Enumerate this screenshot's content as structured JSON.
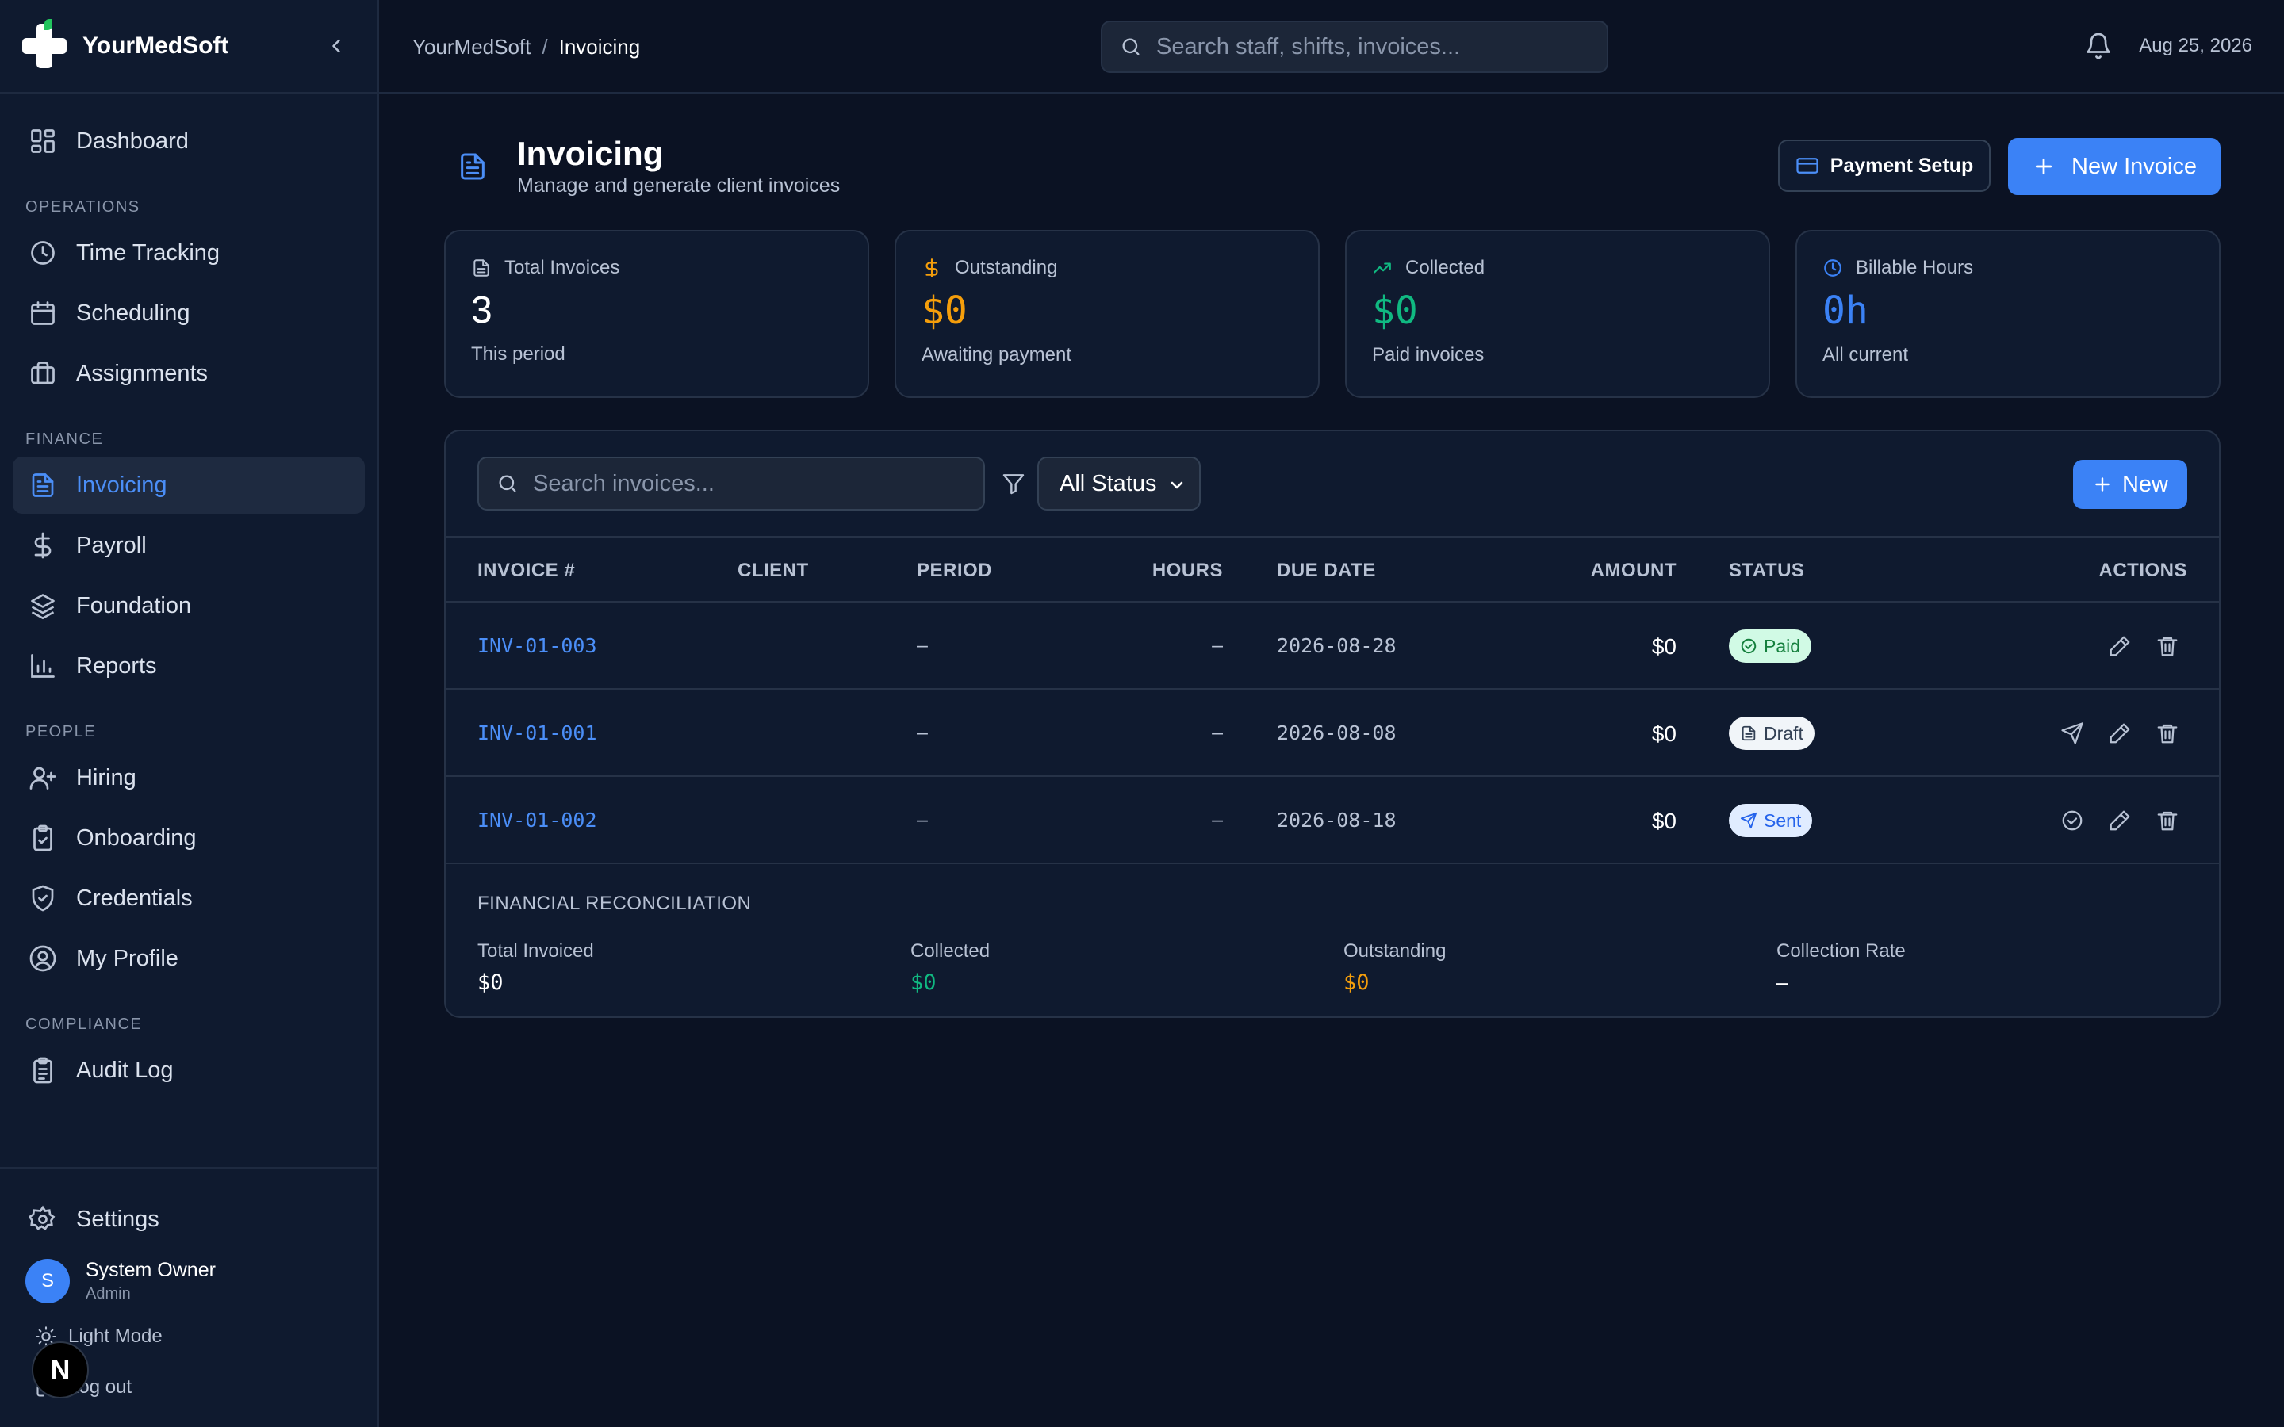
{
  "app": {
    "name": "YourMedSoft"
  },
  "sidebar": {
    "top_items": [
      {
        "label": "Dashboard",
        "icon": "dashboard-icon"
      }
    ],
    "sections": [
      {
        "label": "OPERATIONS",
        "items": [
          {
            "label": "Time Tracking",
            "icon": "clock-icon"
          },
          {
            "label": "Scheduling",
            "icon": "calendar-icon"
          },
          {
            "label": "Assignments",
            "icon": "briefcase-icon"
          }
        ]
      },
      {
        "label": "FINANCE",
        "items": [
          {
            "label": "Invoicing",
            "icon": "file-icon",
            "active": true
          },
          {
            "label": "Payroll",
            "icon": "dollar-icon"
          },
          {
            "label": "Foundation",
            "icon": "layers-icon"
          },
          {
            "label": "Reports",
            "icon": "bar-chart-icon"
          }
        ]
      },
      {
        "label": "PEOPLE",
        "items": [
          {
            "label": "Hiring",
            "icon": "user-plus-icon"
          },
          {
            "label": "Onboarding",
            "icon": "clipboard-check-icon"
          },
          {
            "label": "Credentials",
            "icon": "shield-check-icon"
          },
          {
            "label": "My Profile",
            "icon": "user-circle-icon"
          }
        ]
      },
      {
        "label": "COMPLIANCE",
        "items": [
          {
            "label": "Audit Log",
            "icon": "clipboard-list-icon"
          }
        ]
      }
    ],
    "settings_label": "Settings",
    "user": {
      "initial": "S",
      "name": "System Owner",
      "role": "Admin"
    },
    "theme_label": "Light Mode",
    "logout_label": "Log out",
    "next_badge": "N"
  },
  "topbar": {
    "breadcrumb": [
      "YourMedSoft",
      "Invoicing"
    ],
    "breadcrumb_sep": "/",
    "search_placeholder": "Search staff, shifts, invoices...",
    "date": "Aug 25, 2026"
  },
  "page": {
    "title": "Invoicing",
    "subtitle": "Manage and generate client invoices",
    "payment_setup_label": "Payment Setup",
    "new_invoice_label": "New Invoice"
  },
  "stats": [
    {
      "label": "Total Invoices",
      "value": "3",
      "sub": "This period",
      "color": "#ffffff",
      "icon": "file-icon"
    },
    {
      "label": "Outstanding",
      "value": "$0",
      "sub": "Awaiting payment",
      "color": "#f59e0b",
      "icon": "dollar-icon"
    },
    {
      "label": "Collected",
      "value": "$0",
      "sub": "Paid invoices",
      "color": "#10b981",
      "icon": "trending-up-icon"
    },
    {
      "label": "Billable Hours",
      "value": "0h",
      "sub": "All current",
      "color": "#3b82f6",
      "icon": "clock-icon"
    }
  ],
  "table": {
    "search_placeholder": "Search invoices...",
    "status_filter": "All Status",
    "new_label": "New",
    "columns": [
      "INVOICE #",
      "CLIENT",
      "PERIOD",
      "HOURS",
      "DUE DATE",
      "AMOUNT",
      "STATUS",
      "ACTIONS"
    ],
    "rows": [
      {
        "invoice": "INV-01-003",
        "client": "",
        "period": "–",
        "hours": "–",
        "due": "2026-08-28",
        "amount": "$0",
        "status": "Paid"
      },
      {
        "invoice": "INV-01-001",
        "client": "",
        "period": "–",
        "hours": "–",
        "due": "2026-08-08",
        "amount": "$0",
        "status": "Draft"
      },
      {
        "invoice": "INV-01-002",
        "client": "",
        "period": "–",
        "hours": "–",
        "due": "2026-08-18",
        "amount": "$0",
        "status": "Sent"
      }
    ]
  },
  "reconciliation": {
    "title": "FINANCIAL RECONCILIATION",
    "items": [
      {
        "label": "Total Invoiced",
        "value": "$0",
        "color": "#ffffff"
      },
      {
        "label": "Collected",
        "value": "$0",
        "color": "#10b981"
      },
      {
        "label": "Outstanding",
        "value": "$0",
        "color": "#f59e0b"
      },
      {
        "label": "Collection Rate",
        "value": "–",
        "color": "#ffffff"
      }
    ]
  },
  "colors": {
    "accent": "#3b82f6",
    "background": "#0b1223",
    "panel": "#0f1a2f"
  }
}
